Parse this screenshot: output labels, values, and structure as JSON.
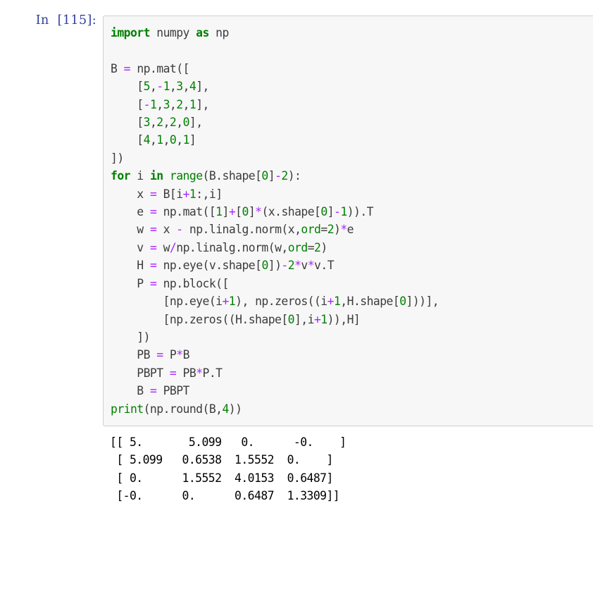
{
  "notebook": {
    "input_cell": {
      "prompt_label": "In  [115]:",
      "prompt_color": "#303f9f",
      "cell_background": "#f7f7f7",
      "cell_border_color": "#cfcfcf",
      "language": "python",
      "code_lines": [
        "import numpy as np",
        "",
        "B = np.mat([",
        "    [5,-1,3,4],",
        "    [-1,3,2,1],",
        "    [3,2,2,0],",
        "    [4,1,0,1]",
        "])",
        "for i in range(B.shape[0]-2):",
        "    x = B[i+1:,i]",
        "    e = np.mat([1]+[0]*(x.shape[0]-1)).T",
        "    w = x - np.linalg.norm(x,ord=2)*e",
        "    v = w/np.linalg.norm(w,ord=2)",
        "    H = np.eye(v.shape[0])-2*v*v.T",
        "    P = np.block([",
        "        [np.eye(i+1), np.zeros((i+1,H.shape[0]))],",
        "        [np.zeros((H.shape[0],i+1)),H]",
        "    ])",
        "    PB = P*B",
        "    PBPT = PB*P.T",
        "    B = PBPT",
        "print(np.round(B,4))"
      ],
      "syntax_colors": {
        "keyword": "#008000",
        "builtin": "#008000",
        "number": "#008000",
        "operator": "#aa22ff",
        "plain": "#3c3c3c"
      }
    },
    "output_cell": {
      "prompt_label": "",
      "text_color": "#000000",
      "output_lines": [
        "[[ 5.       5.099   0.      -0.    ]",
        " [ 5.099   0.6538  1.5552  0.    ]",
        " [ 0.      1.5552  4.0153  0.6487]",
        " [-0.      0.      0.6487  1.3309]]"
      ],
      "matrix": {
        "rows": [
          [
            "5.",
            "5.099",
            "0.",
            "-0."
          ],
          [
            "5.099",
            "0.6538",
            "1.5552",
            "0."
          ],
          [
            "0.",
            "1.5552",
            "4.0153",
            "0.6487"
          ],
          [
            "-0.",
            "0.",
            "0.6487",
            "1.3309"
          ]
        ]
      }
    }
  }
}
